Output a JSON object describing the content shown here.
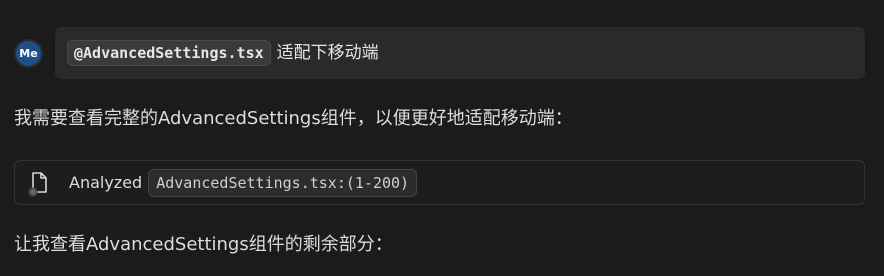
{
  "user_message": {
    "avatar_initials": "Me",
    "mention": "@AdvancedSettings.tsx",
    "text": "适配下移动端"
  },
  "assistant": {
    "line1": "我需要查看完整的AdvancedSettings组件，以便更好地适配移动端：",
    "tool_call": {
      "action_label": "Analyzed",
      "file_ref": "AdvancedSettings.tsx:(1-200)",
      "icon": "file-icon"
    },
    "line2": "让我查看AdvancedSettings组件的剩余部分："
  },
  "colors": {
    "background": "#1b1b1b",
    "bubble": "#2a2a2a",
    "avatar": "#1e4f86"
  }
}
